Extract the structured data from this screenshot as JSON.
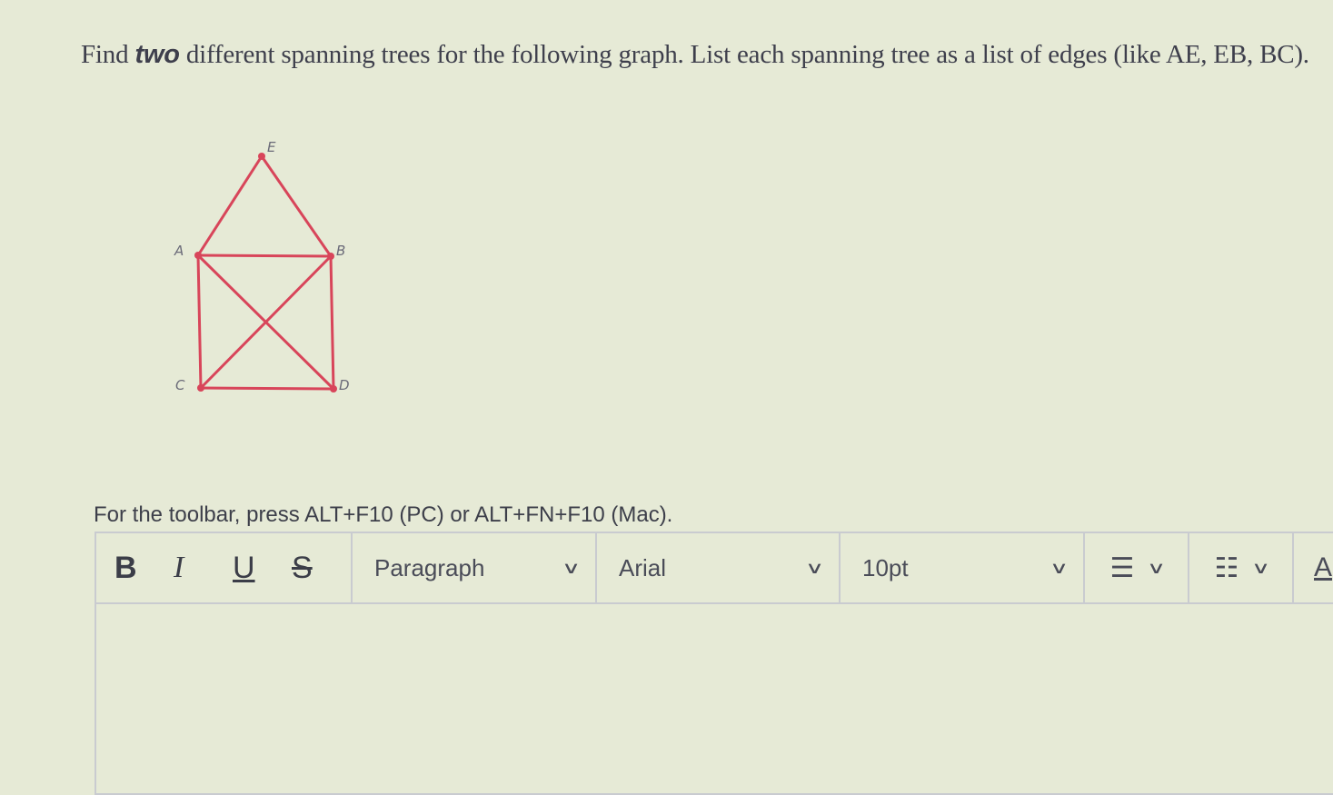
{
  "question": {
    "part1": "Find ",
    "emphasis": "two",
    "part2": " different spanning trees for the following graph. List each spanning tree as a list of edges (like AE, EB, BC)."
  },
  "graph": {
    "vertices": [
      "E",
      "A",
      "B",
      "C",
      "D"
    ],
    "edges": [
      "AE",
      "EB",
      "AB",
      "AC",
      "AD",
      "BC",
      "BD",
      "CD"
    ],
    "edge_color": "#d8455a"
  },
  "toolbar_hint": "For the toolbar, press ALT+F10 (PC) or ALT+FN+F10 (Mac).",
  "toolbar": {
    "bold": "B",
    "italic": "I",
    "underline": "U",
    "strikethrough": "S",
    "paragraph": "Paragraph",
    "font": "Arial",
    "size": "10pt",
    "chevron": "∨",
    "bullet_icon": "☰",
    "numbered_icon": "☷",
    "more": "A"
  }
}
